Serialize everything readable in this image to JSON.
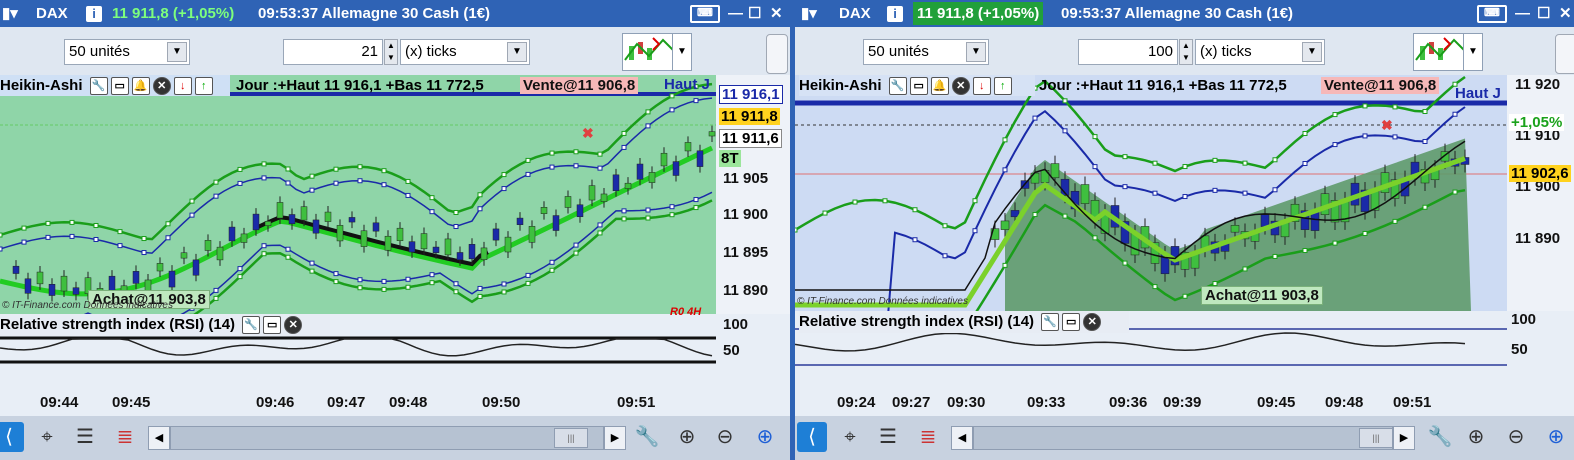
{
  "panels": [
    {
      "symbol": "DAX",
      "price": "11 911,8 (+1,05%)",
      "time_name": "09:53:37 Allemagne 30 Cash (1€)",
      "units": "50 unités",
      "ticks_value": "21",
      "ticks_unit": "(x) ticks",
      "chart_style": "Heikin-Ashi",
      "day_info": "Jour :+Haut 11 916,1 +Bas 11 772,5",
      "sell_order": "Vente@11 906,8",
      "buy_order": "Achat@11 903,8",
      "haut_label": "Haut J",
      "watermark": "© IT-Finance.com  Données indicatives",
      "r_label": "R0 4H",
      "price_tags": [
        "11 916,1",
        "11 911,8",
        "11 911,6",
        "8T"
      ],
      "y_ticks": [
        "11 905",
        "11 900",
        "11 895",
        "11 890"
      ],
      "rsi_title": "Relative strength index (RSI) (14)",
      "rsi_ticks": [
        "100",
        "50"
      ],
      "x_ticks": [
        "09:44",
        "09:45",
        "09:46",
        "09:47",
        "09:48",
        "09:50",
        "09:51"
      ]
    },
    {
      "symbol": "DAX",
      "price": "11 911,8 (+1,05%)",
      "time_name": "09:53:37 Allemagne 30 Cash (1€)",
      "units": "50 unités",
      "ticks_value": "100",
      "ticks_unit": "(x) ticks",
      "chart_style": "Heikin-Ashi",
      "day_info": "Jour :+Haut 11 916,1 +Bas 11 772,5",
      "sell_order": "Vente@11 906,8",
      "buy_order": "Achat@11 903,8",
      "haut_label": "Haut J",
      "watermark": "© IT-Finance.com  Données indicatives",
      "price_tags": [
        "+1,05%",
        "11 902,6"
      ],
      "y_ticks": [
        "11 920",
        "11 910",
        "11 900",
        "11 890"
      ],
      "rsi_title": "Relative strength index (RSI) (14)",
      "rsi_ticks": [
        "100",
        "50"
      ],
      "x_ticks": [
        "09:24",
        "09:27",
        "09:30",
        "09:33",
        "09:36",
        "09:39",
        "09:45",
        "09:48",
        "09:51"
      ]
    }
  ],
  "colors": {
    "title_bar": "#2f63b5",
    "left_plot_bg": "#8fd5a8",
    "right_plot_bg": "#cddbf3",
    "bollinger": "#1a9e1a",
    "envelope": "#1a2aa8",
    "moving_average": "#22cc22",
    "candle_up": "#3fbf3f",
    "candle_down": "#1a2aa8"
  },
  "icons": [
    "instrument-icon",
    "info-icon",
    "keyboard-icon",
    "minimize-icon",
    "maximize-icon",
    "close-icon",
    "chart-type-icon",
    "wrench-icon",
    "window-icon",
    "bell-icon",
    "remove-icon",
    "arrow-down-icon",
    "arrow-up-icon",
    "share-icon",
    "cursor-icon",
    "list-icon",
    "layers-icon",
    "zoom-fit-icon",
    "zoom-out-icon",
    "zoom-in-icon"
  ]
}
